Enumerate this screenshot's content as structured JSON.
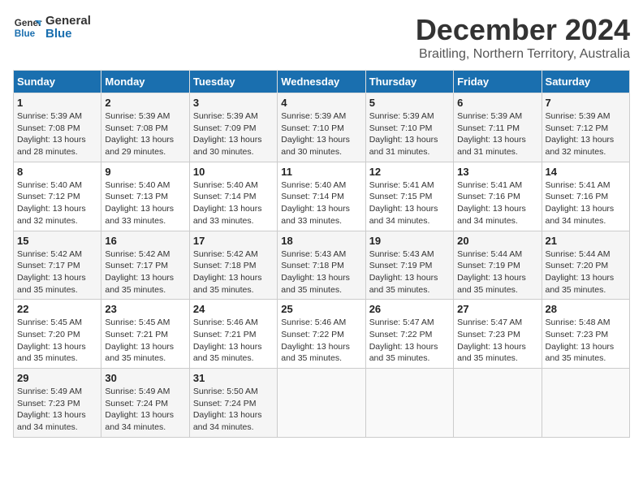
{
  "header": {
    "logo_line1": "General",
    "logo_line2": "Blue",
    "month_title": "December 2024",
    "subtitle": "Braitling, Northern Territory, Australia"
  },
  "columns": [
    "Sunday",
    "Monday",
    "Tuesday",
    "Wednesday",
    "Thursday",
    "Friday",
    "Saturday"
  ],
  "weeks": [
    [
      {
        "day": "1",
        "sunrise": "Sunrise: 5:39 AM",
        "sunset": "Sunset: 7:08 PM",
        "daylight": "Daylight: 13 hours and 28 minutes."
      },
      {
        "day": "2",
        "sunrise": "Sunrise: 5:39 AM",
        "sunset": "Sunset: 7:08 PM",
        "daylight": "Daylight: 13 hours and 29 minutes."
      },
      {
        "day": "3",
        "sunrise": "Sunrise: 5:39 AM",
        "sunset": "Sunset: 7:09 PM",
        "daylight": "Daylight: 13 hours and 30 minutes."
      },
      {
        "day": "4",
        "sunrise": "Sunrise: 5:39 AM",
        "sunset": "Sunset: 7:10 PM",
        "daylight": "Daylight: 13 hours and 30 minutes."
      },
      {
        "day": "5",
        "sunrise": "Sunrise: 5:39 AM",
        "sunset": "Sunset: 7:10 PM",
        "daylight": "Daylight: 13 hours and 31 minutes."
      },
      {
        "day": "6",
        "sunrise": "Sunrise: 5:39 AM",
        "sunset": "Sunset: 7:11 PM",
        "daylight": "Daylight: 13 hours and 31 minutes."
      },
      {
        "day": "7",
        "sunrise": "Sunrise: 5:39 AM",
        "sunset": "Sunset: 7:12 PM",
        "daylight": "Daylight: 13 hours and 32 minutes."
      }
    ],
    [
      {
        "day": "8",
        "sunrise": "Sunrise: 5:40 AM",
        "sunset": "Sunset: 7:12 PM",
        "daylight": "Daylight: 13 hours and 32 minutes."
      },
      {
        "day": "9",
        "sunrise": "Sunrise: 5:40 AM",
        "sunset": "Sunset: 7:13 PM",
        "daylight": "Daylight: 13 hours and 33 minutes."
      },
      {
        "day": "10",
        "sunrise": "Sunrise: 5:40 AM",
        "sunset": "Sunset: 7:14 PM",
        "daylight": "Daylight: 13 hours and 33 minutes."
      },
      {
        "day": "11",
        "sunrise": "Sunrise: 5:40 AM",
        "sunset": "Sunset: 7:14 PM",
        "daylight": "Daylight: 13 hours and 33 minutes."
      },
      {
        "day": "12",
        "sunrise": "Sunrise: 5:41 AM",
        "sunset": "Sunset: 7:15 PM",
        "daylight": "Daylight: 13 hours and 34 minutes."
      },
      {
        "day": "13",
        "sunrise": "Sunrise: 5:41 AM",
        "sunset": "Sunset: 7:16 PM",
        "daylight": "Daylight: 13 hours and 34 minutes."
      },
      {
        "day": "14",
        "sunrise": "Sunrise: 5:41 AM",
        "sunset": "Sunset: 7:16 PM",
        "daylight": "Daylight: 13 hours and 34 minutes."
      }
    ],
    [
      {
        "day": "15",
        "sunrise": "Sunrise: 5:42 AM",
        "sunset": "Sunset: 7:17 PM",
        "daylight": "Daylight: 13 hours and 35 minutes."
      },
      {
        "day": "16",
        "sunrise": "Sunrise: 5:42 AM",
        "sunset": "Sunset: 7:17 PM",
        "daylight": "Daylight: 13 hours and 35 minutes."
      },
      {
        "day": "17",
        "sunrise": "Sunrise: 5:42 AM",
        "sunset": "Sunset: 7:18 PM",
        "daylight": "Daylight: 13 hours and 35 minutes."
      },
      {
        "day": "18",
        "sunrise": "Sunrise: 5:43 AM",
        "sunset": "Sunset: 7:18 PM",
        "daylight": "Daylight: 13 hours and 35 minutes."
      },
      {
        "day": "19",
        "sunrise": "Sunrise: 5:43 AM",
        "sunset": "Sunset: 7:19 PM",
        "daylight": "Daylight: 13 hours and 35 minutes."
      },
      {
        "day": "20",
        "sunrise": "Sunrise: 5:44 AM",
        "sunset": "Sunset: 7:19 PM",
        "daylight": "Daylight: 13 hours and 35 minutes."
      },
      {
        "day": "21",
        "sunrise": "Sunrise: 5:44 AM",
        "sunset": "Sunset: 7:20 PM",
        "daylight": "Daylight: 13 hours and 35 minutes."
      }
    ],
    [
      {
        "day": "22",
        "sunrise": "Sunrise: 5:45 AM",
        "sunset": "Sunset: 7:20 PM",
        "daylight": "Daylight: 13 hours and 35 minutes."
      },
      {
        "day": "23",
        "sunrise": "Sunrise: 5:45 AM",
        "sunset": "Sunset: 7:21 PM",
        "daylight": "Daylight: 13 hours and 35 minutes."
      },
      {
        "day": "24",
        "sunrise": "Sunrise: 5:46 AM",
        "sunset": "Sunset: 7:21 PM",
        "daylight": "Daylight: 13 hours and 35 minutes."
      },
      {
        "day": "25",
        "sunrise": "Sunrise: 5:46 AM",
        "sunset": "Sunset: 7:22 PM",
        "daylight": "Daylight: 13 hours and 35 minutes."
      },
      {
        "day": "26",
        "sunrise": "Sunrise: 5:47 AM",
        "sunset": "Sunset: 7:22 PM",
        "daylight": "Daylight: 13 hours and 35 minutes."
      },
      {
        "day": "27",
        "sunrise": "Sunrise: 5:47 AM",
        "sunset": "Sunset: 7:23 PM",
        "daylight": "Daylight: 13 hours and 35 minutes."
      },
      {
        "day": "28",
        "sunrise": "Sunrise: 5:48 AM",
        "sunset": "Sunset: 7:23 PM",
        "daylight": "Daylight: 13 hours and 35 minutes."
      }
    ],
    [
      {
        "day": "29",
        "sunrise": "Sunrise: 5:49 AM",
        "sunset": "Sunset: 7:23 PM",
        "daylight": "Daylight: 13 hours and 34 minutes."
      },
      {
        "day": "30",
        "sunrise": "Sunrise: 5:49 AM",
        "sunset": "Sunset: 7:24 PM",
        "daylight": "Daylight: 13 hours and 34 minutes."
      },
      {
        "day": "31",
        "sunrise": "Sunrise: 5:50 AM",
        "sunset": "Sunset: 7:24 PM",
        "daylight": "Daylight: 13 hours and 34 minutes."
      },
      null,
      null,
      null,
      null
    ]
  ]
}
